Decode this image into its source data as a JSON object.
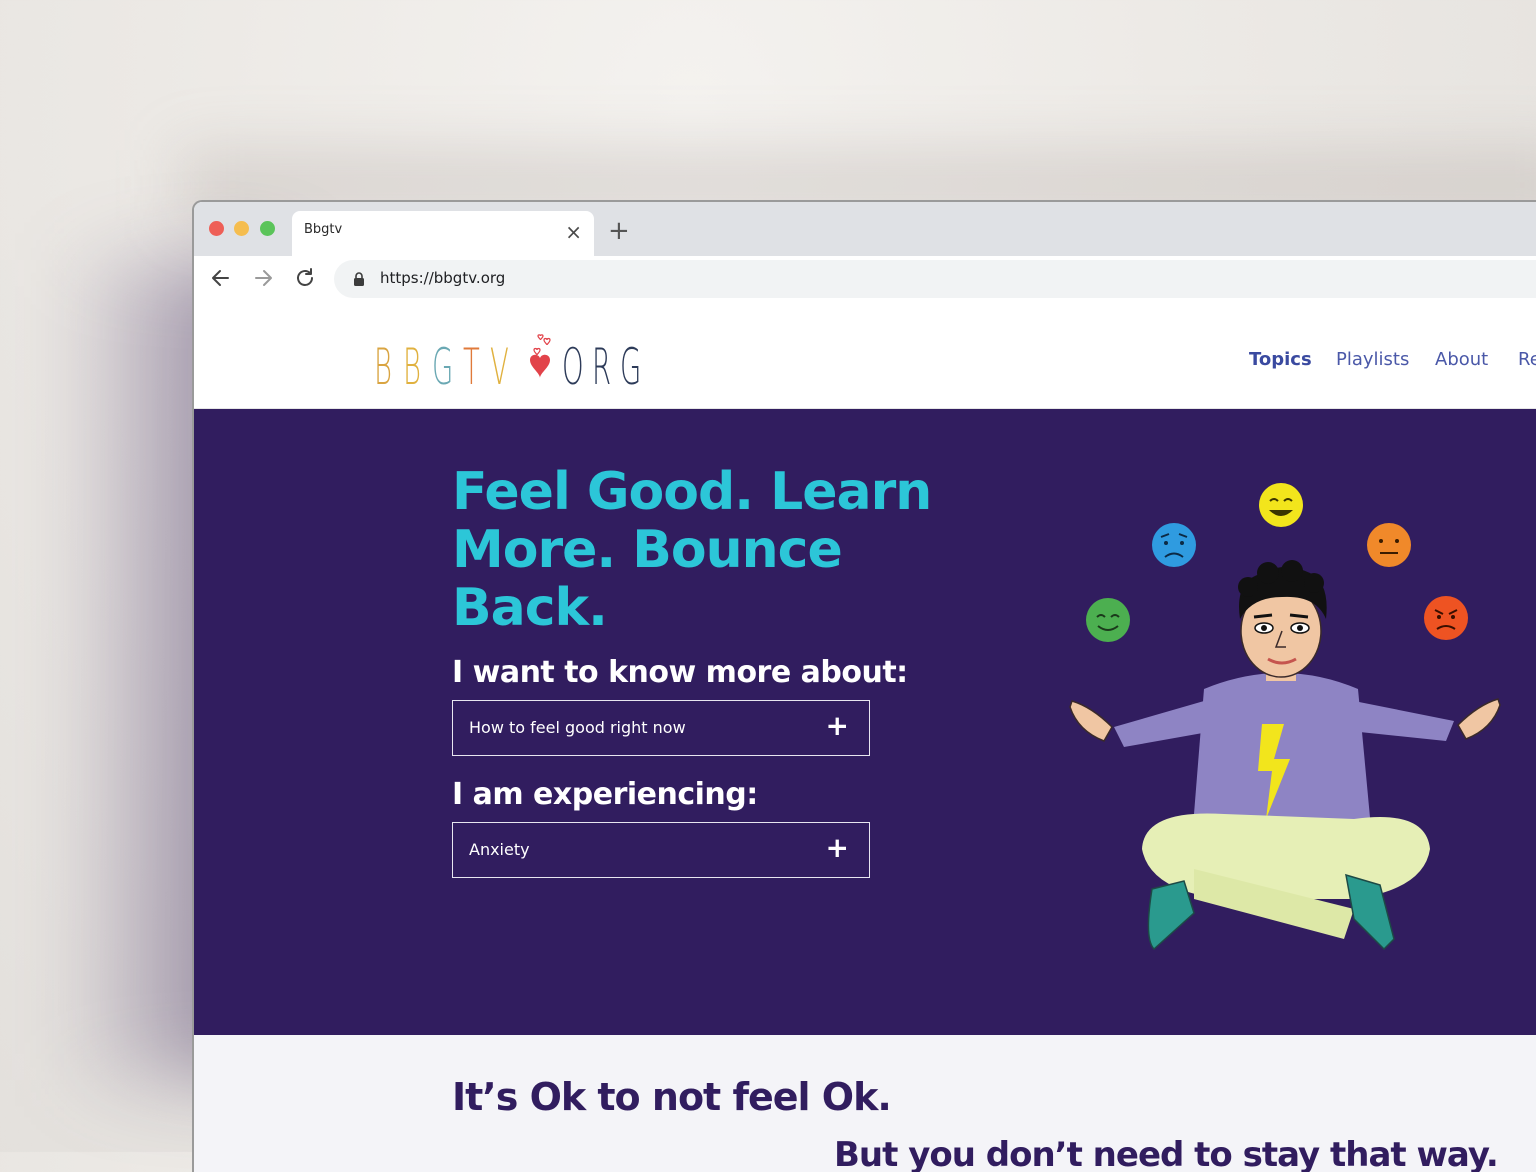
{
  "browser": {
    "tab_title": "Bbgtv",
    "close_glyph": "×",
    "new_tab_glyph": "+",
    "url": "https://bbgtv.org"
  },
  "site": {
    "logo_text": "BBGTV.ORG",
    "nav": [
      {
        "label": "Topics",
        "active": true
      },
      {
        "label": "Playlists",
        "active": false
      },
      {
        "label": "About",
        "active": false
      },
      {
        "label": "Re",
        "active": false
      }
    ]
  },
  "hero": {
    "title": "Feel Good. Learn More. Bounce Back.",
    "know_more_label": "I want to know more about:",
    "know_more_value": "How to feel good right now",
    "experiencing_label": "I am experiencing:",
    "experiencing_value": "Anxiety",
    "plus_glyph": "+"
  },
  "lower": {
    "title": "It’s Ok to not feel Ok.",
    "subtitle": "But you don’t need to stay that way."
  },
  "colors": {
    "hero_bg": "#311d5f",
    "hero_title": "#2cc6d8",
    "nav_link": "#4a58a8",
    "logo_letters": [
      "#d9a441",
      "#e0b13f",
      "#6aa8b3",
      "#e07a3a",
      "#e0b13f",
      "#e2434a",
      "#2d3b59",
      "#2d3b59",
      "#2d3b59"
    ]
  },
  "icons": [
    "back-arrow-icon",
    "forward-arrow-icon",
    "reload-icon",
    "lock-icon",
    "close-icon",
    "plus-icon",
    "heart-icon"
  ]
}
